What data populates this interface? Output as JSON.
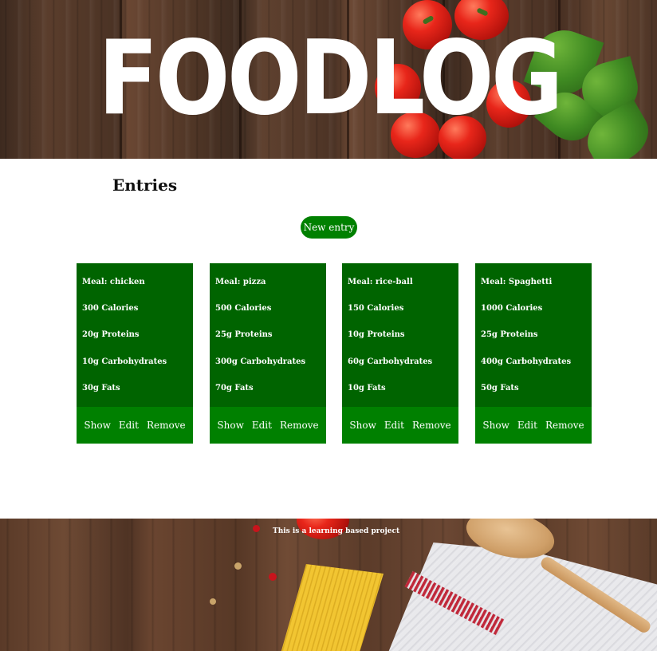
{
  "header": {
    "logo_text": "FOODLOG"
  },
  "main": {
    "title": "Entries",
    "new_entry_label": "New entry",
    "entries": [
      {
        "meal": "Meal: chicken",
        "calories": "300 Calories",
        "proteins": "20g Proteins",
        "carbohydrates": "10g Carbohydrates",
        "fats": "30g Fats"
      },
      {
        "meal": "Meal: pizza",
        "calories": "500 Calories",
        "proteins": "25g Proteins",
        "carbohydrates": "300g Carbohydrates",
        "fats": "70g Fats"
      },
      {
        "meal": "Meal: rice-ball",
        "calories": "150 Calories",
        "proteins": "10g Proteins",
        "carbohydrates": "60g Carbohydrates",
        "fats": "10g Fats"
      },
      {
        "meal": "Meal: Spaghetti",
        "calories": "1000 Calories",
        "proteins": "25g Proteins",
        "carbohydrates": "400g Carbohydrates",
        "fats": "50g Fats"
      }
    ],
    "actions": {
      "show": "Show",
      "edit": "Edit",
      "remove": "Remove"
    }
  },
  "footer": {
    "text": "This is a learning based project"
  },
  "colors": {
    "card_body": "#006400",
    "card_actions": "#008000",
    "button": "#008000"
  }
}
